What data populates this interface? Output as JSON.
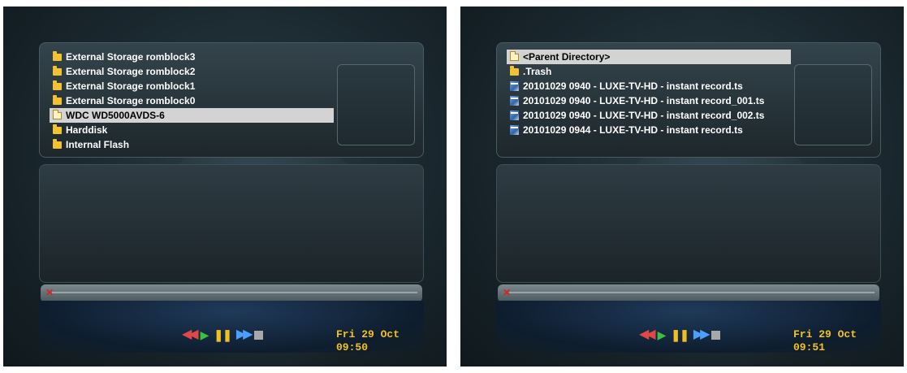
{
  "left_screen": {
    "items": [
      {
        "label": "External Storage romblock3",
        "icon": "folder-icon",
        "selected": false
      },
      {
        "label": "External Storage romblock2",
        "icon": "folder-icon",
        "selected": false
      },
      {
        "label": "External Storage romblock1",
        "icon": "folder-icon",
        "selected": false
      },
      {
        "label": "External Storage romblock0",
        "icon": "folder-icon",
        "selected": false
      },
      {
        "label": "WDC WD5000AVDS-6",
        "icon": "folder-open-icon",
        "selected": true
      },
      {
        "label": "Harddisk",
        "icon": "folder-icon",
        "selected": false
      },
      {
        "label": "Internal Flash",
        "icon": "folder-icon",
        "selected": false
      }
    ],
    "clock": "Fri 29 Oct  09:50"
  },
  "right_screen": {
    "items": [
      {
        "label": "<Parent Directory>",
        "icon": "folder-open-icon",
        "selected": true
      },
      {
        "label": ".Trash",
        "icon": "folder-icon",
        "selected": false
      },
      {
        "label": "20101029 0940 - LUXE-TV-HD - instant record.ts",
        "icon": "movie-icon",
        "selected": false
      },
      {
        "label": "20101029 0940 - LUXE-TV-HD - instant record_001.ts",
        "icon": "movie-icon",
        "selected": false
      },
      {
        "label": "20101029 0940 - LUXE-TV-HD - instant record_002.ts",
        "icon": "movie-icon",
        "selected": false
      },
      {
        "label": "20101029 0944 - LUXE-TV-HD - instant record.ts",
        "icon": "movie-icon",
        "selected": false
      }
    ],
    "clock": "Fri 29 Oct  09:51"
  },
  "controls": {
    "icons": [
      "rewind-icon",
      "play-icon",
      "pause-icon",
      "fast-forward-icon",
      "stop-icon"
    ],
    "rewind_glyph": "◀◀",
    "play_glyph": "▶",
    "pause_glyph": "❚❚",
    "ff_glyph": "▶▶",
    "cross_glyph": "✕"
  },
  "colors": {
    "clock": "#f4c21a",
    "rewind": "#e04848",
    "play": "#39c23a",
    "pause": "#f0c020",
    "fast_forward": "#4aa0ff",
    "stop": "#a8a8a8",
    "selection": "#d3d3d3",
    "folder": "#f2c230"
  }
}
